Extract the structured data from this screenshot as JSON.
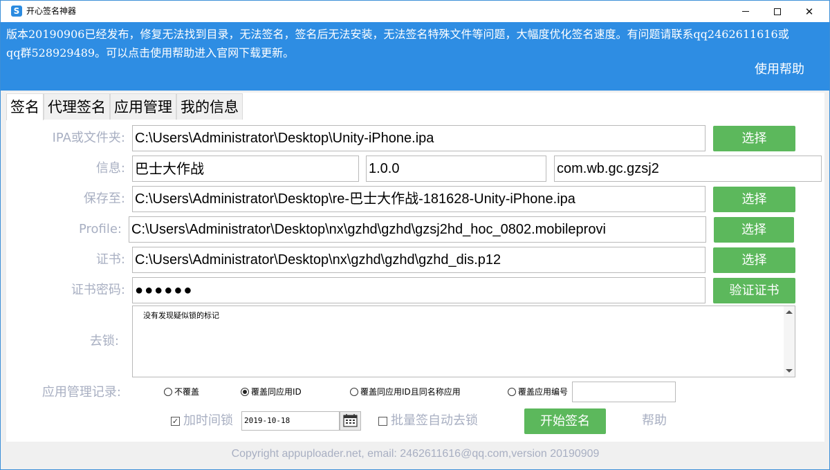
{
  "window": {
    "title": "开心签名神器",
    "icon_name": "app-logo-icon"
  },
  "banner": {
    "notice": "版本20190906已经发布，修复无法找到目录，无法签名，签名后无法安装，无法签名特殊文件等问题，大幅度优化签名速度。有问题请联系qq2462611616或qq群528929489。可以点击使用帮助进入官网下载更新。",
    "help_label": "使用帮助",
    "color": "#2e8de3"
  },
  "tabs": [
    {
      "label": "签名",
      "active": true
    },
    {
      "label": "代理签名",
      "active": false
    },
    {
      "label": "应用管理",
      "active": false
    },
    {
      "label": "我的信息",
      "active": false
    }
  ],
  "form": {
    "ipa_label": "IPA或文件夹:",
    "ipa_value": "C:\\Users\\Administrator\\Desktop\\Unity-iPhone.ipa",
    "info_label": "信息:",
    "app_name": "巴士大作战",
    "version": "1.0.0",
    "bundle_id": "com.wb.gc.gzsj2",
    "save_label": "保存至:",
    "save_value": "C:\\Users\\Administrator\\Desktop\\re-巴士大作战-181628-Unity-iPhone.ipa",
    "profile_label": "Profile:",
    "profile_value": "C:\\Users\\Administrator\\Desktop\\nx\\gzhd\\gzhd\\gzsj2hd_hoc_0802.mobileprovi",
    "cert_label": "证书:",
    "cert_value": "C:\\Users\\Administrator\\Desktop\\nx\\gzhd\\gzhd\\gzhd_dis.p12",
    "password_label": "证书密码:",
    "password_value": "●●●●●●",
    "unlock_label": "去锁:",
    "unlock_text": "没有发现疑似锁的标记",
    "select_label": "选择",
    "verify_label": "验证证书",
    "accent_color": "#5cb85c"
  },
  "app_record": {
    "label": "应用管理记录:",
    "options": [
      {
        "label": "不覆盖",
        "checked": false
      },
      {
        "label": "覆盖同应用ID",
        "checked": true
      },
      {
        "label": "覆盖同应用ID且同名称应用",
        "checked": false
      },
      {
        "label": "覆盖应用编号",
        "checked": false
      }
    ],
    "number_value": ""
  },
  "bottom": {
    "time_lock_label": "加时间锁",
    "time_lock_checked": true,
    "date_value": "2019-10-18",
    "batch_label": "批量签自动去锁",
    "batch_checked": false,
    "start_label": "开始签名",
    "help_label": "帮助"
  },
  "footer": {
    "text": "Copyright appuploader.net, email: 2462611616@qq.com,version 20190909"
  }
}
